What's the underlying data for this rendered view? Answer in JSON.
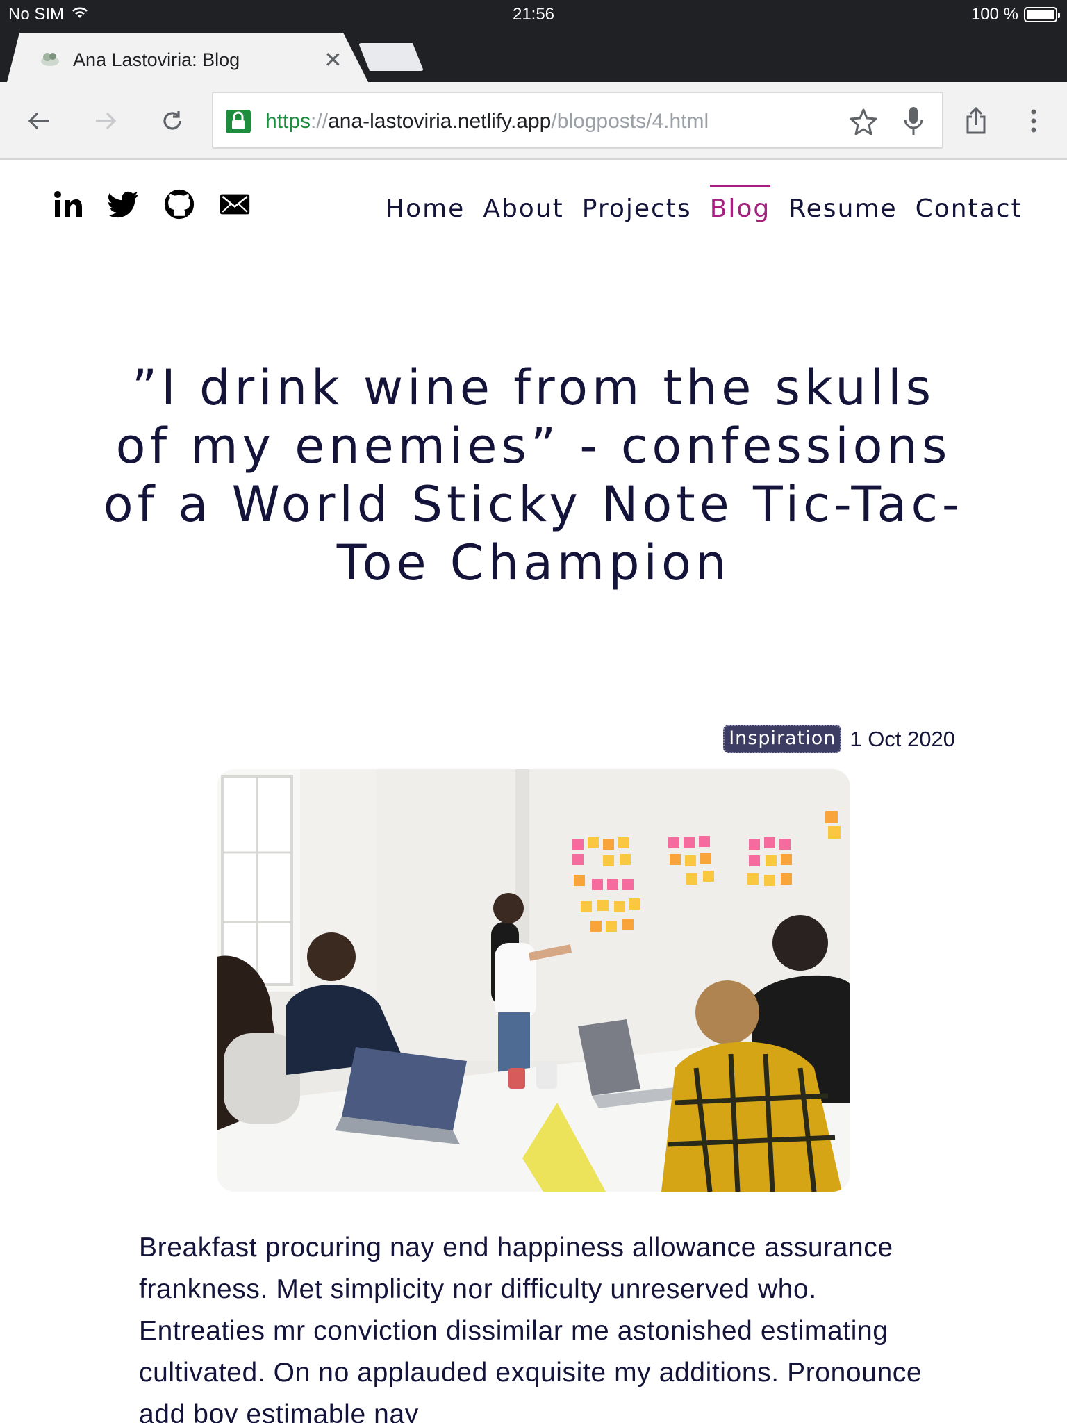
{
  "status_bar": {
    "carrier": "No SIM",
    "time": "21:56",
    "battery": "100 %",
    "battery_level": 1.0
  },
  "browser": {
    "tab_title": "Ana Lastoviria: Blog",
    "url": {
      "scheme": "https",
      "separator": "://",
      "host": "ana-lastoviria.netlify.app",
      "path": "/blogposts/4.html"
    }
  },
  "site": {
    "social_icons": [
      "linkedin-icon",
      "twitter-icon",
      "github-icon",
      "mail-icon"
    ],
    "nav": [
      {
        "label": "Home"
      },
      {
        "label": "About"
      },
      {
        "label": "Projects"
      },
      {
        "label": "Blog",
        "active": true
      },
      {
        "label": "Resume"
      },
      {
        "label": "Contact"
      }
    ],
    "accent_color": "#a3207f",
    "text_color": "#14143a"
  },
  "post": {
    "title": "”I drink wine from the skulls of my enemies” - confessions of a World Sticky Note Tic-Tac-Toe Champion",
    "tag": "Inspiration",
    "date": "1 Oct 2020",
    "body": "Breakfast procuring nay end happiness allowance assurance frankness. Met simplicity nor difficulty unreserved who. Entreaties mr conviction dissimilar me astonished estimating cultivated. On no applauded exquisite my additions. Pronounce add boy estimable nay"
  }
}
